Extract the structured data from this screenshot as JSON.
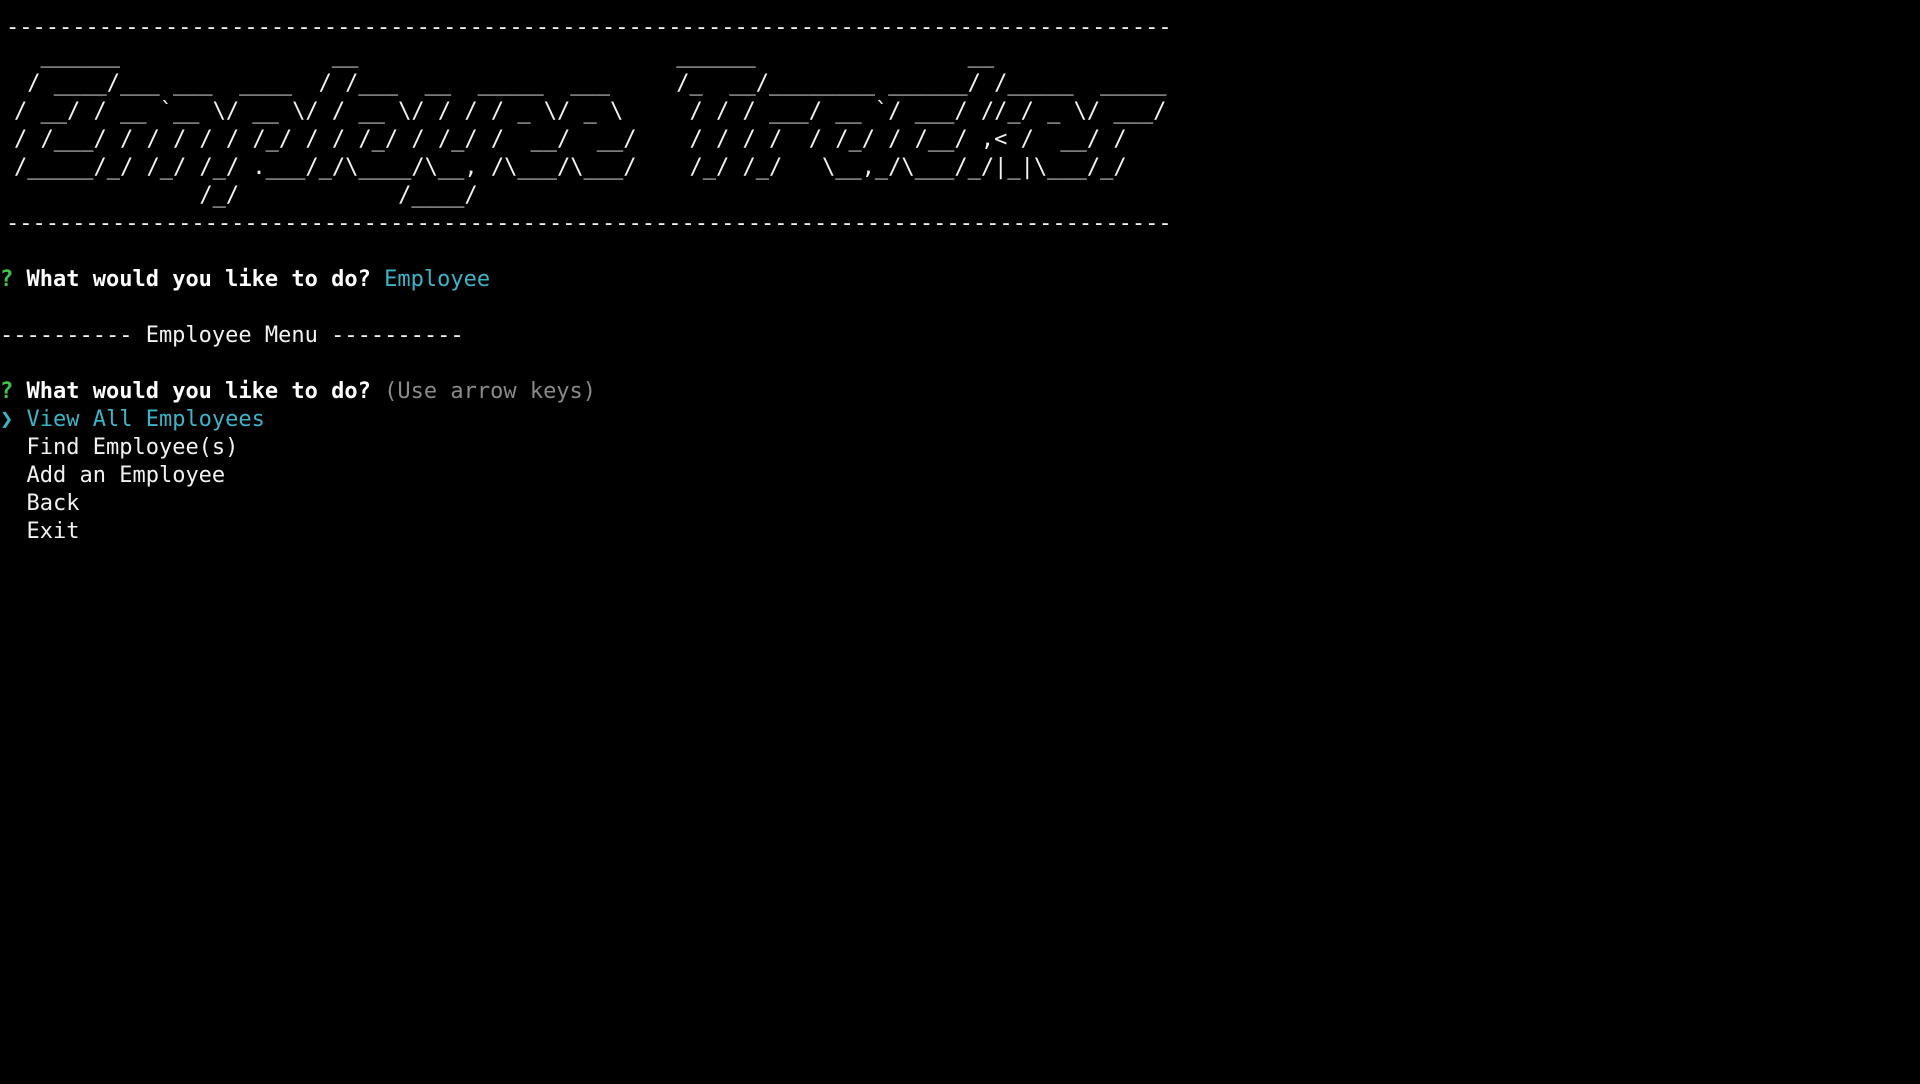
{
  "colors": {
    "background": "#000000",
    "text": "#f2f2f2",
    "prompt_mark": "#3fc34a",
    "answer": "#3cb4c8",
    "hint": "#8a8a8a",
    "selected": "#3cb4c8"
  },
  "banner": {
    "rule_top": "----------------------------------------------------------------------------------------------------------------------------------",
    "art": "  ______                __                        ______                __            \n / ____/___ ___  ____  / /___  __  _____  ___     /_  __/________ ______/ /_____  _____\n/ __/ / __ `__ \\/ __ \\/ / __ \\/ / / / _ \\/ _ \\     / / / ___/ __ `/ ___/ //_/ _ \\/ ___/\n/ /___/ / / / / / /_/ / / /_/ / /_/ /  __/  __/    / / / /  / /_/ / /__/ ,< /  __/ /    \n/_____/_/ /_/ /_/ .___/_/\\____/\\__, /\\___/\\___/    /_/ /_/   \\__,_/\\___/_/|_|\\___/_/     \n              /_/            /____/                                                      ",
    "rule_bottom": "----------------------------------------------------------------------------------------------------------------------------------"
  },
  "first_prompt": {
    "mark": "?",
    "question": "What would you like to do?",
    "answer": "Employee"
  },
  "menu_header": "---------- Employee Menu ----------",
  "second_prompt": {
    "mark": "?",
    "question": "What would you like to do?",
    "hint": "(Use arrow keys)"
  },
  "pointer": "❯",
  "choices": [
    "View All Employees",
    "Find Employee(s)",
    "Add an Employee",
    "Back",
    "Exit"
  ]
}
